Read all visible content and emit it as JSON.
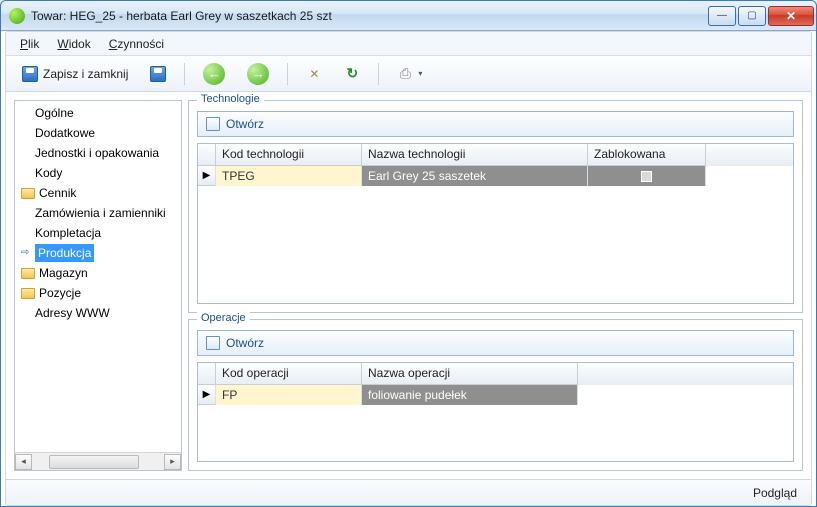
{
  "window": {
    "title": "Towar: HEG_25 - herbata Earl Grey w saszetkach 25 szt"
  },
  "menu": {
    "items": [
      "Plik",
      "Widok",
      "Czynności"
    ],
    "accel": [
      "P",
      "W",
      "C"
    ]
  },
  "toolbar": {
    "save_close": "Zapisz i zamknij"
  },
  "sidebar": {
    "items": [
      {
        "label": "Ogólne",
        "folder": false
      },
      {
        "label": "Dodatkowe",
        "folder": false
      },
      {
        "label": "Jednostki i opakowania",
        "folder": false
      },
      {
        "label": "Kody",
        "folder": false
      },
      {
        "label": "Cennik",
        "folder": true
      },
      {
        "label": "Zamówienia i zamienniki",
        "folder": false
      },
      {
        "label": "Kompletacja",
        "folder": false
      },
      {
        "label": "Produkcja",
        "folder": false,
        "selected": true
      },
      {
        "label": "Magazyn",
        "folder": true
      },
      {
        "label": "Pozycje",
        "folder": true
      },
      {
        "label": "Adresy WWW",
        "folder": false
      }
    ]
  },
  "panels": {
    "tech": {
      "group_label": "Technologie",
      "open_label": "Otwórz",
      "cols": [
        "Kod technologii",
        "Nazwa technologii",
        "Zablokowana"
      ],
      "row": {
        "code": "TPEG",
        "name": "Earl Grey 25 saszetek",
        "locked": false
      }
    },
    "ops": {
      "group_label": "Operacje",
      "open_label": "Otwórz",
      "cols": [
        "Kod operacji",
        "Nazwa operacji"
      ],
      "row": {
        "code": "FP",
        "name": "foliowanie pudełek"
      }
    }
  },
  "statusbar": {
    "right": "Podgląd"
  }
}
